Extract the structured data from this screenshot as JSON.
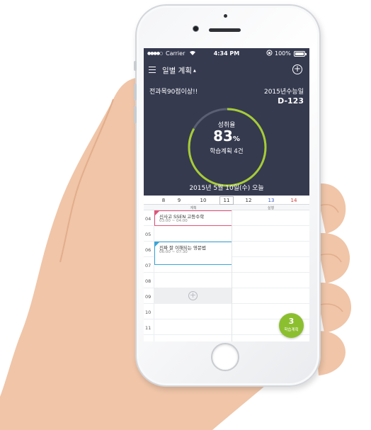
{
  "status_bar": {
    "signal": "●●●●○",
    "carrier": "Carrier",
    "time": "4:34 PM",
    "battery": "100%",
    "battery_level": 1.0
  },
  "nav": {
    "title": "일별 계획",
    "caret": "▲"
  },
  "goal": {
    "title": "전과목90점이상!!",
    "exam": "2015년수능일",
    "dday": "D-123"
  },
  "progress": {
    "label": "성취율",
    "value": "83",
    "unit": "%",
    "value_fraction": 0.83,
    "plans": "학습계획 4건",
    "ring_color": "#a6cc35",
    "track_color": "#5a5f73"
  },
  "today": "2015년 5월 10일(수) 오늘",
  "week": [
    {
      "label": "8",
      "kind": ""
    },
    {
      "label": "9",
      "kind": ""
    },
    {
      "label": "10",
      "kind": ""
    },
    {
      "label": "11",
      "kind": "sel"
    },
    {
      "label": "12",
      "kind": ""
    },
    {
      "label": "13",
      "kind": "sat"
    },
    {
      "label": "14",
      "kind": "sun"
    }
  ],
  "columns": {
    "plan": "계획",
    "exec": "실행"
  },
  "hours": [
    "04",
    "05",
    "06",
    "07",
    "08",
    "09",
    "10",
    "11"
  ],
  "plans": [
    {
      "title": "신사고 SSEN 고등수학",
      "time": "03:00 ~ 04:00",
      "color": "#e0557a"
    },
    {
      "title": "진짜 잘 이해되는 영문법",
      "time": "06:00 ~ 07:30",
      "color": "#3aa5d8"
    }
  ],
  "fab": {
    "count": "3",
    "label": "학습계획"
  },
  "colors": {
    "header_bg": "#353a4f",
    "accent_green": "#8cbf2f"
  }
}
